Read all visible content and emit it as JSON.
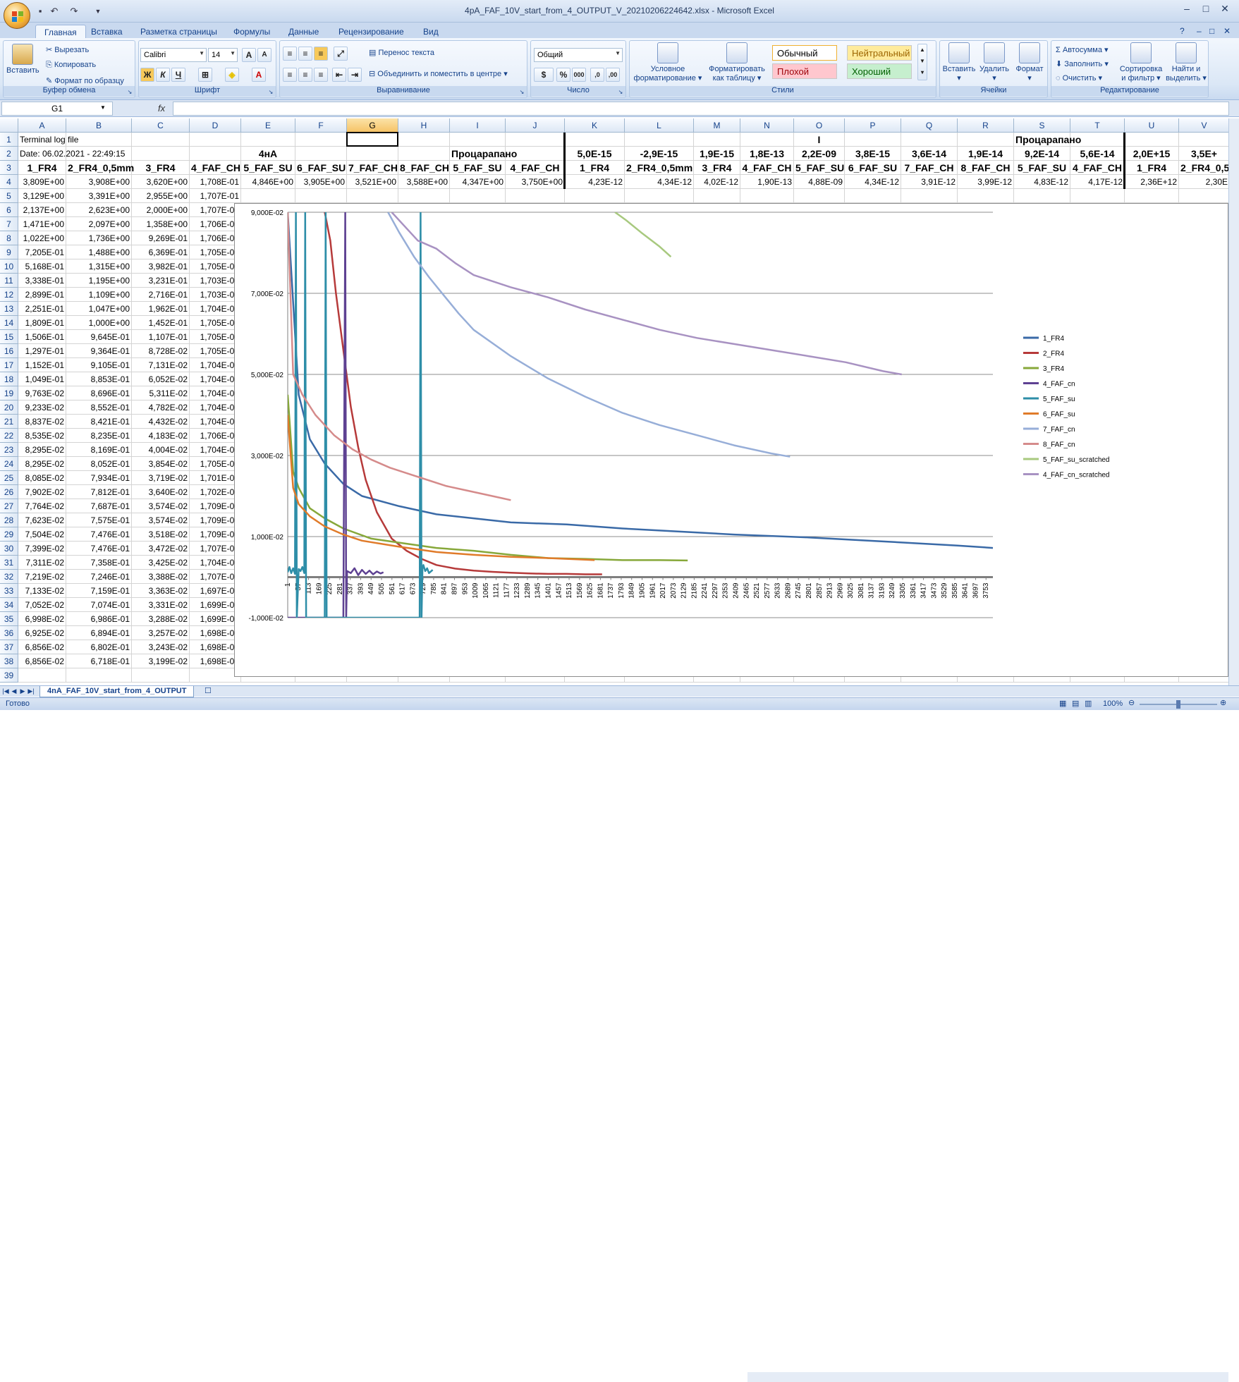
{
  "window": {
    "title": "4pA_FAF_10V_start_from_4_OUTPUT_V_20210206224642.xlsx - Microsoft Excel"
  },
  "ribbon": {
    "tabs": [
      "Главная",
      "Вставка",
      "Разметка страницы",
      "Формулы",
      "Данные",
      "Рецензирование",
      "Вид"
    ],
    "clipboard": {
      "paste": "Вставить",
      "cut": "Вырезать",
      "copy": "Копировать",
      "format_painter": "Формат по образцу",
      "label": "Буфер обмена"
    },
    "font": {
      "name": "Calibri",
      "size": "14",
      "label": "Шрифт"
    },
    "alignment": {
      "wrap": "Перенос текста",
      "merge": "Объединить и поместить в центре",
      "label": "Выравнивание"
    },
    "number": {
      "format": "Общий",
      "label": "Число"
    },
    "styles": {
      "cond_format": [
        "Условное",
        "форматирование"
      ],
      "as_table": [
        "Форматировать",
        "как таблицу"
      ],
      "normal": "Обычный",
      "neutral": "Нейтральный",
      "bad": "Плохой",
      "good": "Хороший",
      "label": "Стили"
    },
    "cells": {
      "insert": "Вставить",
      "delete": "Удалить",
      "format": "Формат",
      "label": "Ячейки"
    },
    "editing": {
      "autosum": "Автосумма",
      "fill": "Заполнить",
      "clear": "Очистить",
      "sort": [
        "Сортировка",
        "и фильтр"
      ],
      "find": [
        "Найти и",
        "выделить"
      ],
      "label": "Редактирование"
    }
  },
  "formula_bar": {
    "name_box": "G1",
    "fx": "fx",
    "value": ""
  },
  "sheet": {
    "columns": [
      "A",
      "B",
      "C",
      "D",
      "E",
      "F",
      "G",
      "H",
      "I",
      "J",
      "K",
      "L",
      "M",
      "N",
      "O",
      "P",
      "Q",
      "R",
      "S",
      "T",
      "U",
      "V"
    ],
    "selected_column": "G",
    "row1": {
      "A": "Terminal log file",
      "O": "I",
      "S": "Процарапано"
    },
    "row2": {
      "A": "Date: 06.02.2021 - 22:49:15",
      "E": "4нА",
      "I": "Процарапано",
      "K": "5,0E-15",
      "L": "-2,9E-15",
      "M": "1,9E-15",
      "N": "1,8E-13",
      "O": "2,2E-09",
      "P": "3,8E-15",
      "Q": "3,6E-14",
      "R": "1,9E-14",
      "S": "9,2E-14",
      "T": "5,6E-14",
      "U": "2,0E+15",
      "V": "3,5E+"
    },
    "row3": [
      "1_FR4",
      "2_FR4_0,5mm",
      "3_FR4",
      "4_FAF_CH",
      "5_FAF_SU",
      "6_FAF_SU",
      "7_FAF_CH",
      "8_FAF_CH",
      "5_FAF_SU",
      "4_FAF_CH",
      "1_FR4",
      "2_FR4_0,5mm",
      "3_FR4",
      "4_FAF_CH",
      "5_FAF_SU",
      "6_FAF_SU",
      "7_FAF_CH",
      "8_FAF_CH",
      "5_FAF_SU",
      "4_FAF_CH",
      "1_FR4",
      "2_FR4_0,5n"
    ],
    "row4": [
      "3,809E+00",
      "3,908E+00",
      "3,620E+00",
      "1,708E-01",
      "4,846E+00",
      "3,905E+00",
      "3,521E+00",
      "3,588E+00",
      "4,347E+00",
      "3,750E+00",
      "4,23E-12",
      "4,34E-12",
      "4,02E-12",
      "1,90E-13",
      "4,88E-09",
      "4,34E-12",
      "3,91E-12",
      "3,99E-12",
      "4,83E-12",
      "4,17E-12",
      "2,36E+12",
      "2,30E"
    ],
    "rows": [
      [
        "3,129E+00",
        "3,391E+00",
        "2,955E+00",
        "1,707E-01"
      ],
      [
        "2,137E+00",
        "2,623E+00",
        "2,000E+00",
        "1,707E-01"
      ],
      [
        "1,471E+00",
        "2,097E+00",
        "1,358E+00",
        "1,706E-01"
      ],
      [
        "1,022E+00",
        "1,736E+00",
        "9,269E-01",
        "1,706E-01"
      ],
      [
        "7,205E-01",
        "1,488E+00",
        "6,369E-01",
        "1,705E-01"
      ],
      [
        "5,168E-01",
        "1,315E+00",
        "3,982E-01",
        "1,705E-01"
      ],
      [
        "3,338E-01",
        "1,195E+00",
        "3,231E-01",
        "1,703E-01"
      ],
      [
        "2,899E-01",
        "1,109E+00",
        "2,716E-01",
        "1,703E-01"
      ],
      [
        "2,251E-01",
        "1,047E+00",
        "1,962E-01",
        "1,704E-01"
      ],
      [
        "1,809E-01",
        "1,000E+00",
        "1,452E-01",
        "1,705E-01"
      ],
      [
        "1,506E-01",
        "9,645E-01",
        "1,107E-01",
        "1,705E-01"
      ],
      [
        "1,297E-01",
        "9,364E-01",
        "8,728E-02",
        "1,705E-01"
      ],
      [
        "1,152E-01",
        "9,105E-01",
        "7,131E-02",
        "1,704E-01"
      ],
      [
        "1,049E-01",
        "8,853E-01",
        "6,052E-02",
        "1,704E-01"
      ],
      [
        "9,763E-02",
        "8,696E-01",
        "5,311E-02",
        "1,704E-01"
      ],
      [
        "9,233E-02",
        "8,552E-01",
        "4,782E-02",
        "1,704E-01"
      ],
      [
        "8,837E-02",
        "8,421E-01",
        "4,432E-02",
        "1,704E-01"
      ],
      [
        "8,535E-02",
        "8,235E-01",
        "4,183E-02",
        "1,706E-01"
      ],
      [
        "8,295E-02",
        "8,169E-01",
        "4,004E-02",
        "1,704E-01"
      ],
      [
        "8,295E-02",
        "8,052E-01",
        "3,854E-02",
        "1,705E-01"
      ],
      [
        "8,085E-02",
        "7,934E-01",
        "3,719E-02",
        "1,701E-01"
      ],
      [
        "7,902E-02",
        "7,812E-01",
        "3,640E-02",
        "1,702E-01"
      ],
      [
        "7,764E-02",
        "7,687E-01",
        "3,574E-02",
        "1,709E-01"
      ],
      [
        "7,623E-02",
        "7,575E-01",
        "3,574E-02",
        "1,709E-01"
      ],
      [
        "7,504E-02",
        "7,476E-01",
        "3,518E-02",
        "1,709E-01"
      ],
      [
        "7,399E-02",
        "7,476E-01",
        "3,472E-02",
        "1,707E-01"
      ],
      [
        "7,311E-02",
        "7,358E-01",
        "3,425E-02",
        "1,704E-01"
      ],
      [
        "7,219E-02",
        "7,246E-01",
        "3,388E-02",
        "1,707E-01"
      ],
      [
        "7,133E-02",
        "7,159E-01",
        "3,363E-02",
        "1,697E-01"
      ],
      [
        "7,052E-02",
        "7,074E-01",
        "3,331E-02",
        "1,699E-01"
      ],
      [
        "6,998E-02",
        "6,986E-01",
        "3,288E-02",
        "1,699E-01"
      ],
      [
        "6,925E-02",
        "6,894E-01",
        "3,257E-02",
        "1,698E-01"
      ],
      [
        "6,856E-02",
        "6,802E-01",
        "3,243E-02",
        "1,698E-01"
      ],
      [
        "6,856E-02",
        "6,718E-01",
        "3,199E-02",
        "1,698E-01"
      ]
    ],
    "first_data_row": 5
  },
  "chart_data": {
    "type": "line",
    "ylim": [
      -0.01,
      0.09
    ],
    "yticks": [
      "9,000E-02",
      "7,000E-02",
      "5,000E-02",
      "3,000E-02",
      "1,000E-02",
      "-1,000E-02"
    ],
    "ytick_values": [
      0.09,
      0.07,
      0.05,
      0.03,
      0.01,
      -0.01
    ],
    "x_tick_labels": [
      "1",
      "57",
      "113",
      "169",
      "225",
      "281",
      "337",
      "393",
      "449",
      "505",
      "561",
      "617",
      "673",
      "729",
      "785",
      "841",
      "897",
      "953",
      "1009",
      "1065",
      "1121",
      "1177",
      "1233",
      "1289",
      "1345",
      "1401",
      "1457",
      "1513",
      "1569",
      "1625",
      "1681",
      "1737",
      "1793",
      "1849",
      "1905",
      "1961",
      "2017",
      "2073",
      "2129",
      "2185",
      "2241",
      "2297",
      "2353",
      "2409",
      "2465",
      "2521",
      "2577",
      "2633",
      "2689",
      "2745",
      "2801",
      "2857",
      "2913",
      "2969",
      "3025",
      "3081",
      "3137",
      "3193",
      "3249",
      "3305",
      "3361",
      "3417",
      "3473",
      "3529",
      "3585",
      "3641",
      "3697",
      "3753"
    ],
    "xlim": [
      1,
      3790
    ],
    "series": [
      {
        "name": "1_FR4",
        "color": "#3a6aa7",
        "x": [
          1,
          60,
          120,
          200,
          300,
          400,
          600,
          800,
          1000,
          1200,
          1500,
          1800,
          2000,
          2400,
          2800,
          3200,
          3600,
          3790
        ],
        "y": [
          0.09,
          0.045,
          0.034,
          0.028,
          0.023,
          0.02,
          0.0175,
          0.0155,
          0.0145,
          0.0135,
          0.013,
          0.012,
          0.0115,
          0.0105,
          0.0098,
          0.0088,
          0.0078,
          0.0072
        ]
      },
      {
        "name": "2_FR4",
        "color": "#b63a3a",
        "x": [
          200,
          230,
          260,
          300,
          340,
          380,
          420,
          480,
          560,
          640,
          720,
          800,
          900,
          1000,
          1100,
          1200,
          1300,
          1400,
          1500,
          1600,
          1690
        ],
        "y": [
          0.09,
          0.083,
          0.07,
          0.056,
          0.042,
          0.032,
          0.024,
          0.016,
          0.0095,
          0.0065,
          0.0045,
          0.003,
          0.0021,
          0.0016,
          0.0013,
          0.0011,
          0.0009,
          0.0008,
          0.0008,
          0.0007,
          0.0007
        ]
      },
      {
        "name": "3_FR4",
        "color": "#87a83a",
        "x": [
          1,
          30,
          60,
          120,
          200,
          300,
          450,
          600,
          800,
          1000,
          1200,
          1400,
          1600,
          1800,
          2000,
          2150
        ],
        "y": [
          0.045,
          0.026,
          0.022,
          0.017,
          0.0145,
          0.012,
          0.0095,
          0.0085,
          0.0072,
          0.0065,
          0.0055,
          0.0047,
          0.0045,
          0.0042,
          0.0042,
          0.0041
        ]
      },
      {
        "name": "4_FAF_cn",
        "color": "#5e4192",
        "x": [
          1,
          300,
          310,
          315,
          320,
          340,
          360,
          380,
          400,
          420,
          440,
          460,
          480,
          500,
          515
        ],
        "y": [
          -0.01,
          -0.01,
          0.09,
          -0.01,
          0.0015,
          0.001,
          0.0022,
          0.0005,
          0.0018,
          0.0008,
          0.0016,
          0.0007,
          0.0014,
          0.0009,
          0.0012
        ]
      },
      {
        "name": "5_FAF_su",
        "color": "#2e8ea8",
        "x": [
          1,
          10,
          20,
          30,
          40,
          45,
          50,
          60,
          70,
          80,
          90,
          95,
          100,
          200,
          205,
          210,
          710,
          715,
          720,
          725,
          730,
          740,
          750,
          760,
          780
        ],
        "y": [
          0.0012,
          0.0025,
          0.001,
          0.0022,
          0.0008,
          0.09,
          -0.01,
          0.002,
          0.0015,
          0.0025,
          0.001,
          0.09,
          -0.01,
          -0.01,
          0.09,
          -0.01,
          -0.01,
          0.09,
          -0.01,
          0.002,
          0.003,
          0.0015,
          0.0022,
          0.001,
          0.0018
        ]
      },
      {
        "name": "6_FAF_su",
        "color": "#e07b2a",
        "x": [
          1,
          30,
          60,
          120,
          200,
          300,
          400,
          600,
          800,
          1000,
          1200,
          1400,
          1600,
          1650
        ],
        "y": [
          0.04,
          0.022,
          0.018,
          0.015,
          0.0125,
          0.0105,
          0.009,
          0.0075,
          0.0062,
          0.0055,
          0.005,
          0.0047,
          0.0043,
          0.0042
        ]
      },
      {
        "name": "7_FAF_cn",
        "color": "#97aed8",
        "x": [
          540,
          600,
          680,
          760,
          840,
          920,
          1000,
          1200,
          1400,
          1600,
          1800,
          2000,
          2200,
          2400,
          2600,
          2700
        ],
        "y": [
          0.09,
          0.085,
          0.079,
          0.074,
          0.0695,
          0.065,
          0.061,
          0.0545,
          0.049,
          0.0445,
          0.0405,
          0.0375,
          0.035,
          0.0325,
          0.0305,
          0.0297
        ]
      },
      {
        "name": "8_FAF_cn",
        "color": "#d58b8b",
        "x": [
          1,
          30,
          80,
          150,
          250,
          350,
          450,
          550,
          650,
          750,
          850,
          950,
          1050,
          1150,
          1200
        ],
        "y": [
          0.09,
          0.05,
          0.045,
          0.04,
          0.035,
          0.0315,
          0.029,
          0.027,
          0.0255,
          0.024,
          0.0225,
          0.0215,
          0.0205,
          0.0195,
          0.019
        ]
      },
      {
        "name": "5_FAF_su_scratched",
        "color": "#a8c97f",
        "x": [
          1760,
          1790,
          1820,
          1900,
          2000,
          2060
        ],
        "y": [
          0.09,
          0.089,
          0.088,
          0.085,
          0.0815,
          0.079
        ]
      },
      {
        "name": "4_FAF_cn_scratched",
        "color": "#a892c2",
        "x": [
          560,
          700,
          800,
          900,
          1000,
          1200,
          1400,
          1600,
          1800,
          2000,
          2200,
          2400,
          2600,
          2800,
          3000,
          3200,
          3300
        ],
        "y": [
          0.09,
          0.083,
          0.081,
          0.0775,
          0.0745,
          0.0715,
          0.069,
          0.066,
          0.0635,
          0.061,
          0.059,
          0.0575,
          0.056,
          0.0545,
          0.053,
          0.0508,
          0.05
        ]
      }
    ]
  },
  "sheet_tab": "4nA_FAF_10V_start_from_4_OUTPUT",
  "status": {
    "ready": "Готово",
    "zoom": "100%"
  }
}
